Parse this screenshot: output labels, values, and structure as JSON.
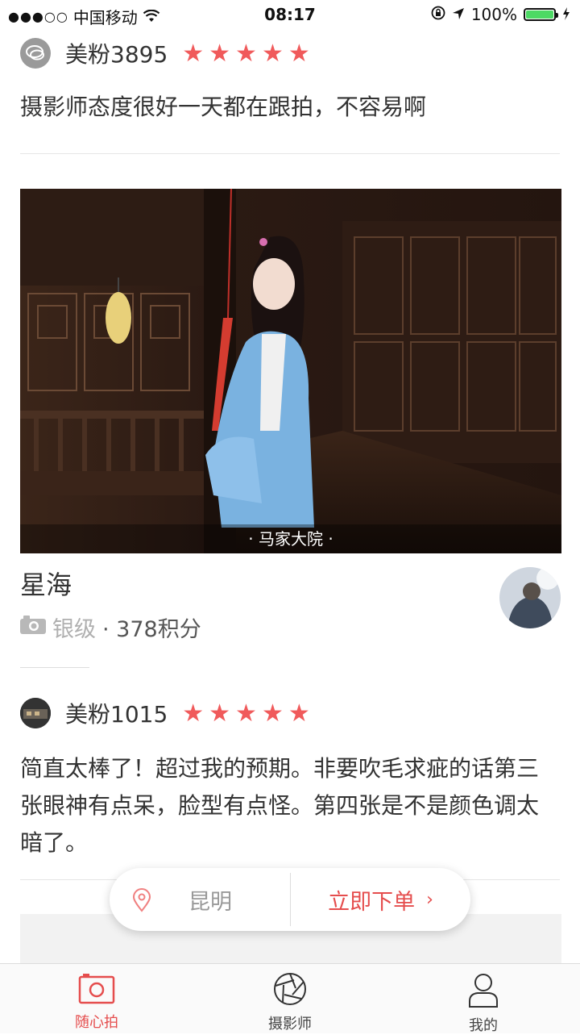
{
  "status_bar": {
    "signal_dots": "●●●○○",
    "carrier": "中国移动",
    "time": "08:17",
    "battery": "100%",
    "battery_color": "#4cd964"
  },
  "review_top": {
    "username": "美粉3895",
    "rating": 5,
    "stars": "★★★★★",
    "text": "摄影师态度很好一天都在跟拍，不容易啊"
  },
  "photo": {
    "caption": "· 马家大院 ·"
  },
  "photographer": {
    "name": "星海",
    "level": "银级",
    "points": "· 378积分"
  },
  "review_second": {
    "username": "美粉1015",
    "rating": 5,
    "stars": "★★★★★",
    "text": "简直太棒了！超过我的预期。非要吹毛求疵的话第三张眼神有点呆，脸型有点怪。第四张是不是颜色调太暗了。"
  },
  "order_pill": {
    "city": "昆明",
    "order_label": "立即下单",
    "chevron": "›"
  },
  "tabbar": {
    "tabs": [
      {
        "label": "随心拍",
        "icon": "camera-icon",
        "active": true
      },
      {
        "label": "摄影师",
        "icon": "aperture-icon",
        "active": false
      },
      {
        "label": "我的",
        "icon": "user-icon",
        "active": false
      }
    ]
  },
  "colors": {
    "accent": "#e54d4d",
    "star": "#f05a5b"
  }
}
